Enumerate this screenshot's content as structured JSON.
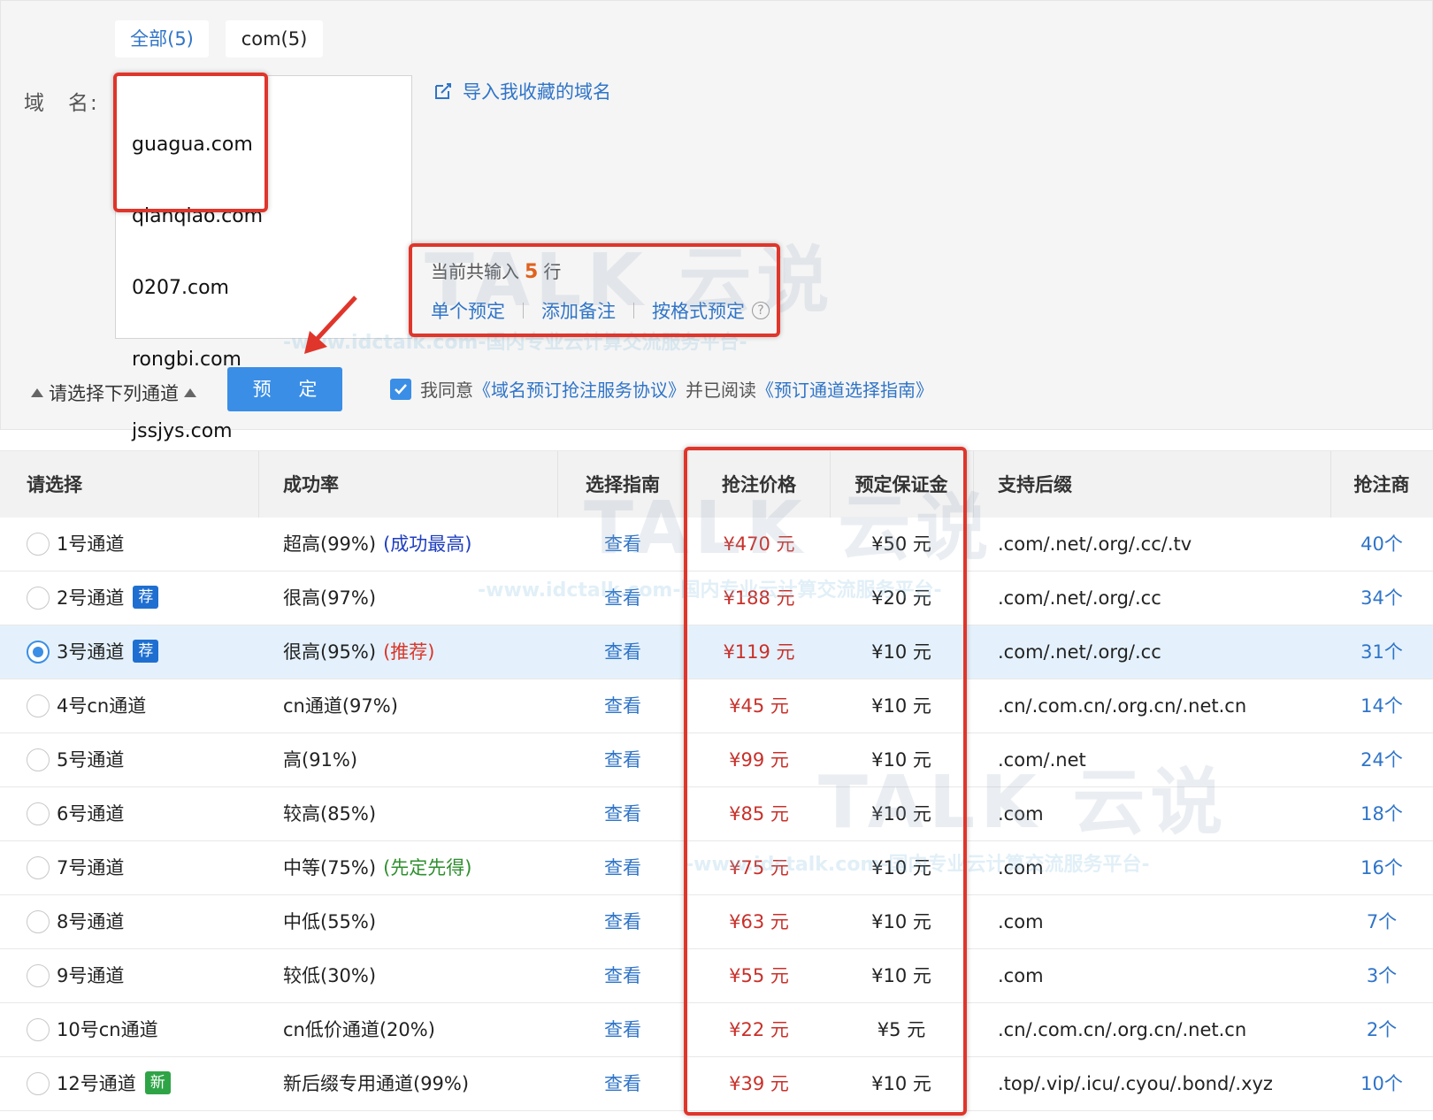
{
  "filters": [
    {
      "label": "全部(5)"
    },
    {
      "label": "com(5)"
    }
  ],
  "domain_form": {
    "label_main": "域　名",
    "label_sep": ":",
    "domains": [
      "guagua.com",
      "qianqiao.com",
      "0207.com",
      "rongbi.com",
      "jssjys.com"
    ],
    "import_link": "导入我收藏的域名",
    "count_prefix": "当前共输入",
    "count_value": "5",
    "count_suffix": "行",
    "single_reserve": "单个预定",
    "add_note": "添加备注",
    "format_reserve": "按格式预定",
    "help": "?"
  },
  "controls": {
    "channel_select": "请选择下列通道",
    "reserve_button": "预 定",
    "agree_prefix": "我同意",
    "agreement": "《域名预订抢注服务协议》",
    "agree_mid": "并已阅读",
    "guide": "《预订通道选择指南》"
  },
  "watermark": {
    "brand": "TALK 云说",
    "site": "-www.idctalk.com-国内专业云计算交流服务平台-"
  },
  "table": {
    "headers": [
      "请选择",
      "成功率",
      "选择指南",
      "抢注价格",
      "预定保证金",
      "支持后缀",
      "抢注商"
    ],
    "rows": [
      {
        "channel": "1号通道",
        "badge": "",
        "rate": "超高(99%)",
        "note": "(成功最高)",
        "note_color": "blue",
        "guide": "查看",
        "price": "¥470 元",
        "deposit": "¥50 元",
        "suffix": ".com/.net/.org/.cc/.tv",
        "vendors": "40个",
        "selected": false
      },
      {
        "channel": "2号通道",
        "badge": "荐",
        "rate": "很高(97%)",
        "note": "",
        "note_color": "",
        "guide": "查看",
        "price": "¥188 元",
        "deposit": "¥20 元",
        "suffix": ".com/.net/.org/.cc",
        "vendors": "34个",
        "selected": false
      },
      {
        "channel": "3号通道",
        "badge": "荐",
        "rate": "很高(95%)",
        "note": "(推荐)",
        "note_color": "red",
        "guide": "查看",
        "price": "¥119 元",
        "deposit": "¥10 元",
        "suffix": ".com/.net/.org/.cc",
        "vendors": "31个",
        "selected": true
      },
      {
        "channel": "4号cn通道",
        "badge": "",
        "rate": "cn通道(97%)",
        "note": "",
        "note_color": "",
        "guide": "查看",
        "price": "¥45 元",
        "deposit": "¥10 元",
        "suffix": ".cn/.com.cn/.org.cn/.net.cn",
        "vendors": "14个",
        "selected": false
      },
      {
        "channel": "5号通道",
        "badge": "",
        "rate": "高(91%)",
        "note": "",
        "note_color": "",
        "guide": "查看",
        "price": "¥99 元",
        "deposit": "¥10 元",
        "suffix": ".com/.net",
        "vendors": "24个",
        "selected": false
      },
      {
        "channel": "6号通道",
        "badge": "",
        "rate": "较高(85%)",
        "note": "",
        "note_color": "",
        "guide": "查看",
        "price": "¥85 元",
        "deposit": "¥10 元",
        "suffix": ".com",
        "vendors": "18个",
        "selected": false
      },
      {
        "channel": "7号通道",
        "badge": "",
        "rate": "中等(75%)",
        "note": "(先定先得)",
        "note_color": "green",
        "guide": "查看",
        "price": "¥75 元",
        "deposit": "¥10 元",
        "suffix": ".com",
        "vendors": "16个",
        "selected": false
      },
      {
        "channel": "8号通道",
        "badge": "",
        "rate": "中低(55%)",
        "note": "",
        "note_color": "",
        "guide": "查看",
        "price": "¥63 元",
        "deposit": "¥10 元",
        "suffix": ".com",
        "vendors": "7个",
        "selected": false
      },
      {
        "channel": "9号通道",
        "badge": "",
        "rate": "较低(30%)",
        "note": "",
        "note_color": "",
        "guide": "查看",
        "price": "¥55 元",
        "deposit": "¥10 元",
        "suffix": ".com",
        "vendors": "3个",
        "selected": false
      },
      {
        "channel": "10号cn通道",
        "badge": "",
        "rate": "cn低价通道(20%)",
        "note": "",
        "note_color": "",
        "guide": "查看",
        "price": "¥22 元",
        "deposit": "¥5 元",
        "suffix": ".cn/.com.cn/.org.cn/.net.cn",
        "vendors": "2个",
        "selected": false
      },
      {
        "channel": "12号通道",
        "badge": "新",
        "rate": "新后缀专用通道(99%)",
        "note": "",
        "note_color": "",
        "guide": "查看",
        "price": "¥39 元",
        "deposit": "¥10 元",
        "suffix": ".top/.vip/.icu/.cyou/.bond/.xyz",
        "vendors": "10个",
        "selected": false
      }
    ]
  },
  "colors": {
    "accent": "#3a8ee6",
    "link": "#2f74c8",
    "price": "#c8302a",
    "annotation": "#e0352b",
    "selected_row": "#e4f1fc"
  },
  "icons": [
    "edit-icon",
    "help-icon",
    "checkbox-checked-icon",
    "triangle-up-icon",
    "arrow-annotation-icon"
  ]
}
